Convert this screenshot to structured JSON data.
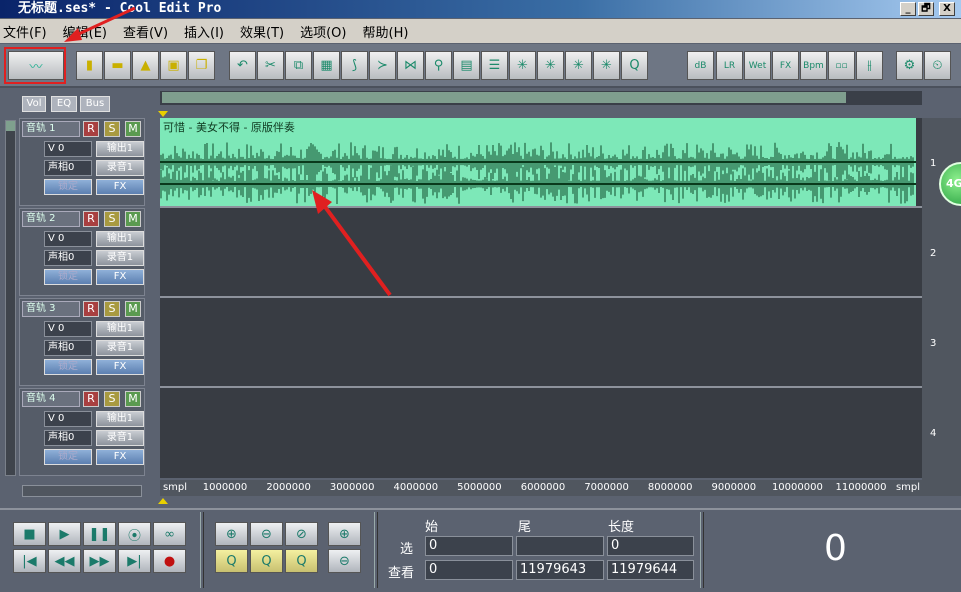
{
  "window": {
    "title": "无标题.ses* - Cool Edit Pro",
    "minimize": "_",
    "restore": "🗗",
    "close": "X"
  },
  "menu": [
    "文件(F)",
    "编辑(E)",
    "查看(V)",
    "插入(I)",
    "效果(T)",
    "选项(O)",
    "帮助(H)"
  ],
  "toolbar": {
    "icons": [
      "waveform-edit-view",
      "new-file",
      "open-file",
      "open-append",
      "save",
      "save-all",
      "undo",
      "cut-scissors",
      "copy",
      "paste",
      "split",
      "trim",
      "mix",
      "lock",
      "group",
      "align",
      "insert-silence",
      "fade",
      "loop",
      "envelope",
      "clip-move",
      "volume-db",
      "pan-lr",
      "wet-dry",
      "fx",
      "bpm",
      "link",
      "snap",
      "mixer-settings",
      "time-lock"
    ],
    "labels": {
      "db": "dB",
      "lr": "L R",
      "wet": "Wet",
      "fx": "FX",
      "bpm": "Bpm"
    }
  },
  "panel_tabs": [
    "Vol",
    "EQ",
    "Bus"
  ],
  "tracks": [
    {
      "name": "音轨 1",
      "number": "1",
      "volume": "V 0",
      "pan": "声相0",
      "output": "输出1",
      "record": "录音1",
      "lock": "锁定",
      "fx": "FX",
      "r": "R",
      "s": "S",
      "m": "M",
      "clip": "可惜 - 美女不得 - 原版伴奏"
    },
    {
      "name": "音轨 2",
      "number": "2",
      "volume": "V 0",
      "pan": "声相0",
      "output": "输出1",
      "record": "录音1",
      "lock": "锁定",
      "fx": "FX",
      "r": "R",
      "s": "S",
      "m": "M"
    },
    {
      "name": "音轨 3",
      "number": "3",
      "volume": "V 0",
      "pan": "声相0",
      "output": "输出1",
      "record": "录音1",
      "lock": "锁定",
      "fx": "FX",
      "r": "R",
      "s": "S",
      "m": "M"
    },
    {
      "name": "音轨 4",
      "number": "4",
      "volume": "V 0",
      "pan": "声相0",
      "output": "输出1",
      "record": "录音1",
      "lock": "锁定",
      "fx": "FX",
      "r": "R",
      "s": "S",
      "m": "M"
    }
  ],
  "overview_fraction": 0.9,
  "ruler": [
    "smpl",
    "1000000",
    "2000000",
    "3000000",
    "4000000",
    "5000000",
    "6000000",
    "7000000",
    "8000000",
    "9000000",
    "10000000",
    "11000000",
    "smpl"
  ],
  "badge": "4G",
  "transport": [
    "stop",
    "play",
    "pause",
    "play-to-end",
    "loop",
    "go-to-start",
    "rewind",
    "fast-forward",
    "go-to-end",
    "record"
  ],
  "zoom": [
    "zoom-in",
    "zoom-out",
    "zoom-full",
    "zoom-in-vertical",
    "zoom-left",
    "zoom-selection",
    "zoom-right",
    "zoom-out-vertical"
  ],
  "selection": {
    "headers": [
      "始",
      "尾",
      "长度"
    ],
    "rows": [
      {
        "label": "选",
        "begin": "0",
        "end": "",
        "length": "0"
      },
      {
        "label": "查看",
        "begin": "0",
        "end": "11979643",
        "length": "11979644"
      }
    ]
  },
  "time_display": "0",
  "colors": {
    "wave_bg": "#7de8b8",
    "wave": "#0f4a2a",
    "accent": "#e02020"
  }
}
